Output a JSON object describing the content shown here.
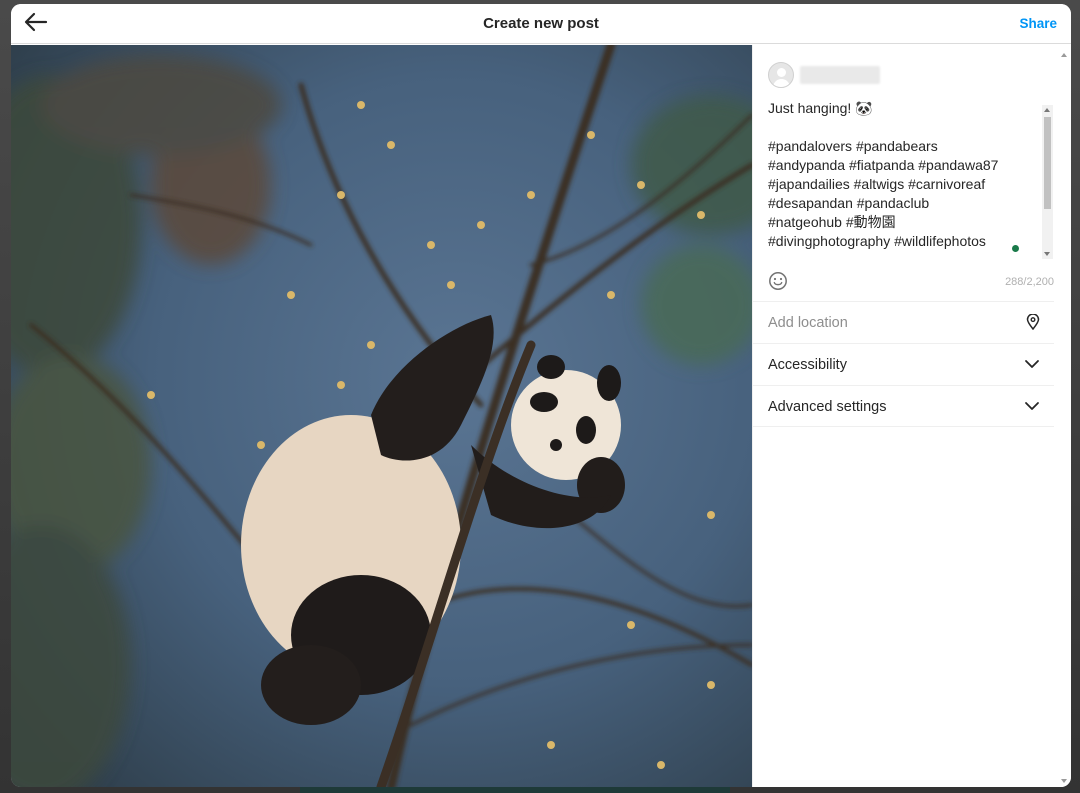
{
  "header": {
    "title": "Create new post",
    "share_label": "Share"
  },
  "post": {
    "caption_first_line": "Just hanging! 🐼",
    "hashtags": "#pandalovers #pandabears\n#andypanda #fiatpanda #pandawa87\n#japandailies #altwigs #carnivoreaf\n#desapandan #pandaclub\n#natgeohub #動物園\n#divingphotography #wildlifephotos\n#pandalady #flashphotography",
    "char_count": "288/2,200"
  },
  "settings": {
    "add_location_placeholder": "Add location",
    "accessibility_label": "Accessibility",
    "advanced_settings_label": "Advanced settings"
  },
  "colors": {
    "accent": "#0095f6",
    "status_dot": "#1a7a4a"
  },
  "icons": {
    "back": "arrow-left-icon",
    "emoji": "smiley-icon",
    "location": "location-pin-icon",
    "expand": "chevron-down-icon"
  }
}
